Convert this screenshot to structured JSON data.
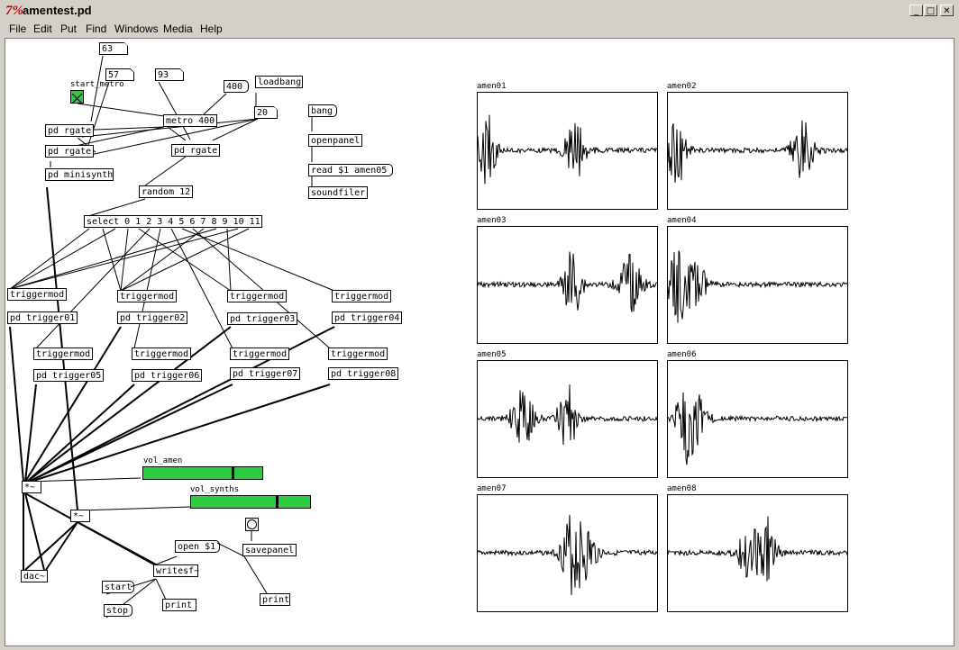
{
  "window": {
    "title": "amentest.pd",
    "app_icon_glyph": "7%"
  },
  "menus": [
    "File",
    "Edit",
    "Put",
    "Find",
    "Windows",
    "Media",
    "Help"
  ],
  "objects": {
    "num_63": "63",
    "num_57": "57",
    "num_93": "93",
    "msg_400": "400",
    "loadbang": "loadbang",
    "start_metro_label": "start_metro",
    "metro": "metro 400",
    "num_20": "20",
    "rgate1": "pd rgate",
    "rgate2": "pd rgate",
    "rgate3": "pd rgate",
    "minisynth": "pd minisynth",
    "random": "random 12",
    "select": "select 0 1 2 3 4 5 6 7 8 9 10 11",
    "bang_msg": "bang",
    "openpanel": "openpanel",
    "read_msg": "read $1 amen05",
    "soundfiler": "soundfiler",
    "triggermod": "triggermod",
    "trigger01": "pd trigger01",
    "trigger02": "pd trigger02",
    "trigger03": "pd trigger03",
    "trigger04": "pd trigger04",
    "trigger05": "pd trigger05",
    "trigger06": "pd trigger06",
    "trigger07": "pd trigger07",
    "trigger08": "pd trigger08",
    "times1": "*~",
    "times2": "*~",
    "vol_amen": "vol_amen",
    "vol_synths": "vol_synths",
    "dac": "dac~",
    "open_msg": "open $1",
    "writesf": "writesf~",
    "savepanel": "savepanel",
    "start_msg": "start",
    "stop_msg": "stop",
    "print1": "print",
    "print2": "print"
  },
  "sliders": {
    "vol_amen_level": 0.76,
    "vol_synths_level": 0.73,
    "color": "#2ecc40"
  },
  "arrays": [
    "amen01",
    "amen02",
    "amen03",
    "amen04",
    "amen05",
    "amen06",
    "amen07",
    "amen08"
  ]
}
